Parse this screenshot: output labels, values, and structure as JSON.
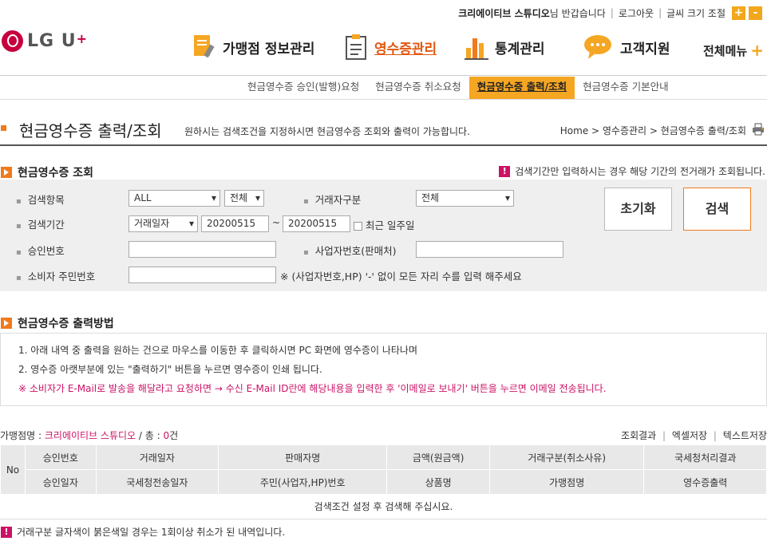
{
  "util": {
    "store_name": "크리에이티브 스튜디오",
    "greeting": "님 반갑습니다",
    "logout": "로그아웃",
    "font_size": "글씨 크기 조절",
    "font_up": "+",
    "font_down": "-"
  },
  "logo": {
    "text": "LG U",
    "plus": "+"
  },
  "gnb": [
    {
      "label": "가맹점 정보관리",
      "icon": "store-info-icon"
    },
    {
      "label": "영수증관리",
      "icon": "receipt-icon",
      "active": true
    },
    {
      "label": "통계관리",
      "icon": "bar-chart-icon"
    },
    {
      "label": "고객지원",
      "icon": "speech-bubble-icon"
    }
  ],
  "allmenu": {
    "label": "전체메뉴",
    "plus": "+"
  },
  "lnb": [
    "현금영수증 승인(발행)요청",
    "현금영수증 취소요청",
    "현금영수증 출력/조회",
    "현금영수증 기본안내"
  ],
  "page": {
    "title": "현금영수증 출력/조회",
    "desc": "원하시는 검색조건을 지정하시면 현금영수증 조회와 출력이 가능합니다.",
    "breadcrumb": "Home > 영수증관리 > 현금영수증 출력/조회"
  },
  "search": {
    "section_title": "현금영수증 조회",
    "notice": "검색기간만 입력하시는 경우 해당 기간의 전거래가 조회됩니다.",
    "item_label": "검색항목",
    "item_value": "ALL",
    "item_sub": "전체",
    "trade_type_label": "거래자구분",
    "trade_type_value": "전체",
    "period_label": "검색기간",
    "period_type": "거래일자",
    "date_from": "20200515",
    "tilde": "~",
    "date_to": "20200515",
    "recent_week": "최근 일주일",
    "approval_label": "승인번호",
    "biz_no_label": "사업자번호(판매처)",
    "consumer_label": "소비자 주민번호",
    "consumer_hint": "※ (사업자번호,HP) '-' 없이 모든 자리 수를 입력 해주세요",
    "reset_button": "초기화",
    "search_button": "검색"
  },
  "method": {
    "section_title": "현금영수증 출력방법",
    "line1": "1. 아래 내역 중 출력을 원하는 건으로 마우스를 이동한 후 클릭하시면 PC 화면에 영수증이 나타나며",
    "line2": "2. 영수증 아랫부분에 있는 \"출력하기\" 버튼을 누르면 영수증이 인쇄 됩니다.",
    "line3": "※ 소비자가 E-Mail로 발송을 해달라고 요청하면 → 수신 E-Mail ID란에 해당내용을 입력한 후 '이메일로 보내기' 버튼을 누르면 이메일 전송됩니다."
  },
  "results": {
    "store_label": "가맹점명 :",
    "store_name": "크리에이티브 스튜디오",
    "total_label": "/ 총 :",
    "total_count": "0",
    "total_unit": "건",
    "link_results": "조회결과",
    "link_excel": "엑셀저장",
    "link_text": "텍스트저장",
    "no_header": "No",
    "header_row1": [
      "승인번호",
      "거래일자",
      "판매자명",
      "금액(원금액)",
      "거래구분(취소사유)",
      "국세청처리결과"
    ],
    "header_row2": [
      "승인일자",
      "국세청전송일자",
      "주민(사업자,HP)번호",
      "상품명",
      "가맹점명",
      "영수증출력"
    ],
    "empty_message": "검색조건 설정 후 검색해 주십시요."
  },
  "footer_note": "거래구분 글자색이 붉은색일 경우는 1회이상 취소가 된 내역입니다.",
  "colors": {
    "accent": "#f07a1c",
    "tab_active": "#f5a623",
    "alert": "#cc1166"
  }
}
